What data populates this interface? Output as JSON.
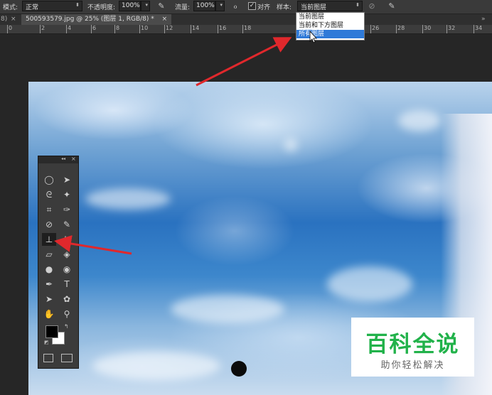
{
  "options_bar": {
    "mode_label": "模式:",
    "mode_value": "正常",
    "opacity_label": "不透明度:",
    "opacity_value": "100%",
    "flow_label": "流量:",
    "flow_value": "100%",
    "aligned_label": "对齐",
    "aligned_checked": true,
    "sample_label": "样本:",
    "sample_value": "当前图层",
    "sample_options": [
      "当前图层",
      "当前和下方图层",
      "所有图层"
    ],
    "sample_hover_index": 2
  },
  "tabs": {
    "left_stub": "8)",
    "document_tab": "500593579.jpg @ 25% (图层 1, RGB/8) *",
    "close_glyph": "×"
  },
  "ruler": {
    "labels": [
      "0",
      "2",
      "4",
      "6",
      "8",
      "10",
      "12",
      "14",
      "16",
      "18",
      "26",
      "28",
      "30",
      "32",
      "34"
    ]
  },
  "tools_panel": {
    "collapse_glyph": "◂◂",
    "close_glyph": "×",
    "active_tool": "clone-stamp-tool",
    "foreground_color": "#000000",
    "background_color": "#ffffff"
  },
  "watermark": {
    "title": "百科全说",
    "subtitle": "助你轻松解决",
    "title_color": "#21b24a"
  },
  "colors": {
    "annotation_arrow": "#e0282c",
    "selected_item": "#2f7ad8"
  }
}
